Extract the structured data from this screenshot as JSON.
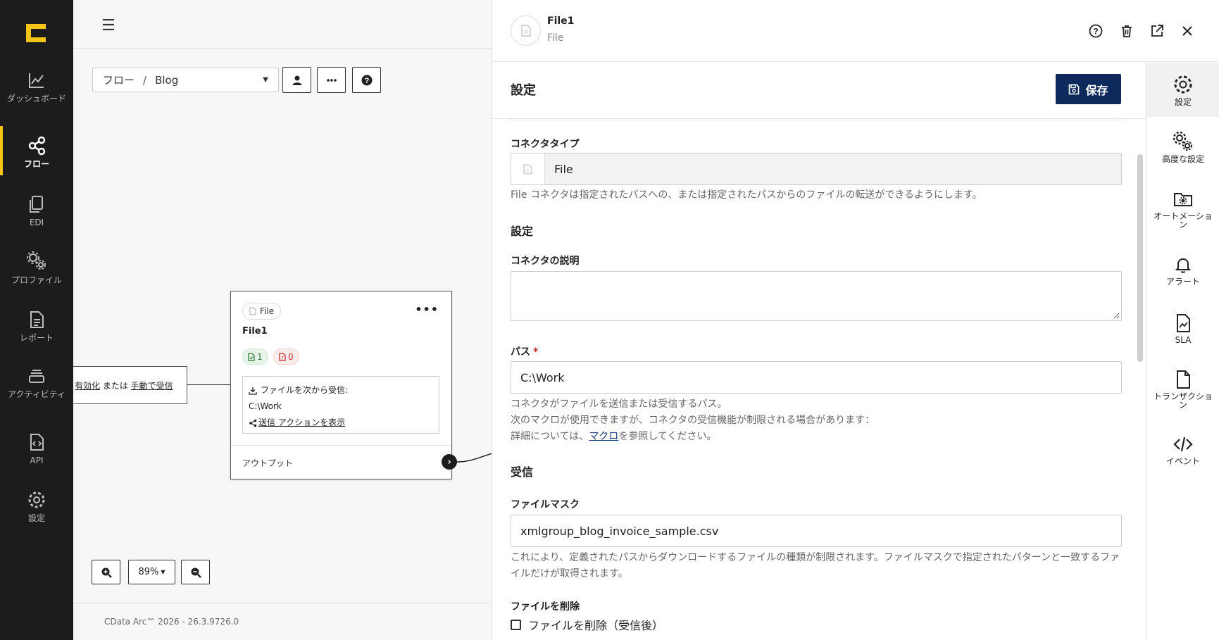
{
  "nav": {
    "items": [
      {
        "label": "ダッシュボード",
        "icon": "chart-line-icon"
      },
      {
        "label": "フロー",
        "icon": "share-icon",
        "active": true
      },
      {
        "label": "EDI",
        "icon": "copy-icon"
      },
      {
        "label": "プロファイル",
        "icon": "gears-icon"
      },
      {
        "label": "レポート",
        "icon": "document-icon"
      },
      {
        "label": "アクティビティ",
        "icon": "layers-icon"
      },
      {
        "label": "API",
        "icon": "file-code-icon"
      },
      {
        "label": "設定",
        "icon": "gear-icon"
      }
    ]
  },
  "canvas": {
    "breadcrumb_root": "フロー",
    "breadcrumb_sep": "/",
    "breadcrumb_current": "Blog",
    "left_stub": {
      "link1": "有効化",
      "middle": " または ",
      "link2": "手動で受信"
    },
    "node": {
      "type_chip": "File",
      "title": "File1",
      "badge_success": "1",
      "badge_error": "0",
      "receive_label": "ファイルを次から受信:",
      "receive_path": "C:\\Work",
      "send_action_link": "送信 アクションを表示",
      "output_label": "アウトプット"
    },
    "zoom_level": "89%",
    "version": "CData Arc™ 2026 - 26.3.9726.0"
  },
  "panel": {
    "name": "File1",
    "type": "File",
    "section_title": "設定",
    "save_label": "保存",
    "connector_type_label": "コネクタタイプ",
    "connector_type_value": "File",
    "connector_type_help": "File コネクタは指定されたパスへの、または指定されたパスからのファイルの転送ができるようにします。",
    "settings_heading": "設定",
    "description_label": "コネクタの説明",
    "description_value": "",
    "path_label": "パス",
    "required_mark": "*",
    "path_value": "C:\\Work",
    "path_help1": "コネクタがファイルを送信または受信するパス。",
    "path_help2": "次のマクロが使用できますが、コネクタの受信機能が制限される場合があります：",
    "path_help3_pre": "詳細については、",
    "path_help3_link": "マクロ",
    "path_help3_post": "を参照してください。",
    "receive_heading": "受信",
    "filemask_label": "ファイルマスク",
    "filemask_value": "xmlgroup_blog_invoice_sample.csv",
    "filemask_help": "これにより、定義されたパスからダウンロードするファイルの種類が制限されます。ファイルマスクで指定されたパターンと一致するファイルだけが取得されます。",
    "delete_label": "ファイルを削除",
    "delete_checkbox_label": "ファイルを削除（受信後）"
  },
  "side_tabs": [
    {
      "label": "設定",
      "icon": "gear-icon",
      "active": true
    },
    {
      "label": "高度な設定",
      "icon": "gears-icon"
    },
    {
      "label": "オートメーション",
      "icon": "folder-gear-icon"
    },
    {
      "label": "アラート",
      "icon": "bell-icon"
    },
    {
      "label": "SLA",
      "icon": "file-chart-icon"
    },
    {
      "label": "トランザクション",
      "icon": "file-icon"
    },
    {
      "label": "イベント",
      "icon": "code-icon"
    }
  ],
  "colors": {
    "accent": "#f5c518",
    "save_button": "#0e2a5c",
    "nav_bg": "#1c1c1c"
  }
}
